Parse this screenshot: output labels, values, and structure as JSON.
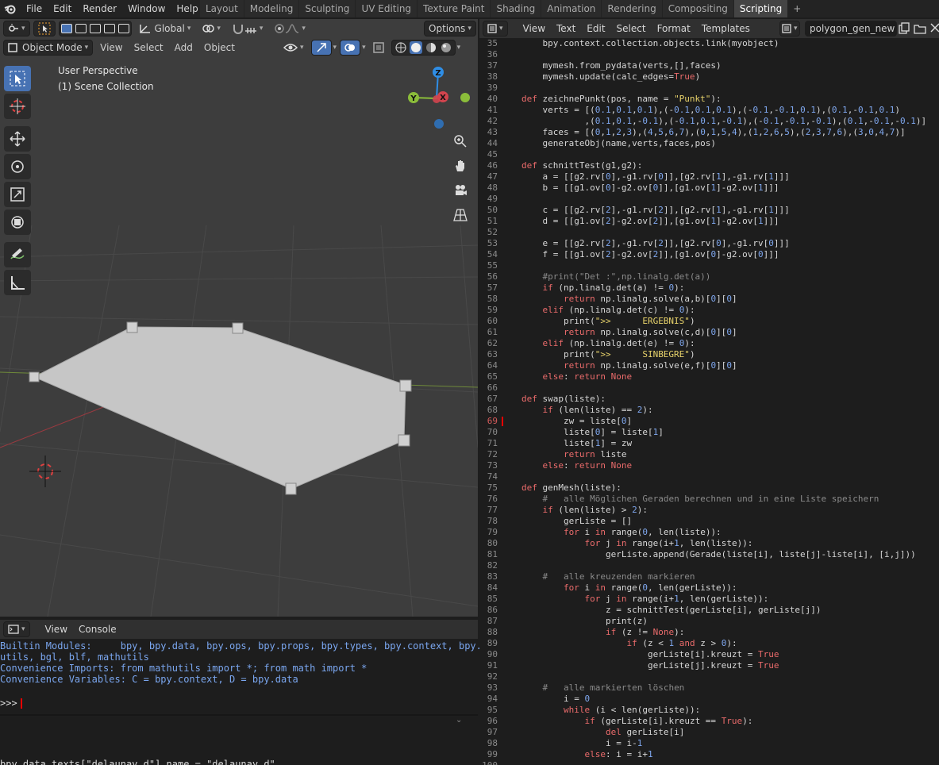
{
  "topbar": {
    "menus": [
      "File",
      "Edit",
      "Render",
      "Window",
      "Help"
    ],
    "workspaces": [
      "Layout",
      "Modeling",
      "Sculpting",
      "UV Editing",
      "Texture Paint",
      "Shading",
      "Animation",
      "Rendering",
      "Compositing",
      "Scripting"
    ],
    "active_workspace": "Scripting",
    "add_tab": "+"
  },
  "viewport": {
    "transform_orientation": "Global",
    "options_label": "Options",
    "mode": "Object Mode",
    "menus": [
      "View",
      "Select",
      "Add",
      "Object"
    ],
    "perspective": "User Perspective",
    "collection": "(1) Scene Collection",
    "gizmo_axes": {
      "z": "Z",
      "y": "Y",
      "x": "X"
    },
    "colors": {
      "background": "#3d3d3d",
      "mesh": "#c6c6c6",
      "x_axis": "#d1444e",
      "y_axis": "#8bbd3a",
      "z_axis": "#2f8ee6",
      "selection": "#4772b3"
    }
  },
  "console": {
    "menus": [
      "View",
      "Console"
    ],
    "lines": [
      "Builtin Modules:     bpy, bpy.data, bpy.ops, bpy.props, bpy.types, bpy.context, bpy.",
      "utils, bgl, blf, mathutils",
      "Convenience Imports: from mathutils import *; from math import *",
      "Convenience Variables: C = bpy.context, D = bpy.data"
    ],
    "prompt": ">>>"
  },
  "info": {
    "text": "bpy.data.texts[\"delaunay.d\"].name = \"delaunay.d\""
  },
  "editor": {
    "menus": [
      "View",
      "Text",
      "Edit",
      "Select",
      "Format",
      "Templates"
    ],
    "text_name": "polygon_gen_new",
    "current_line": 69,
    "lines": [
      {
        "n": "35",
        "t": "    bpy.context.collection.objects.link(myobject)"
      },
      {
        "n": "36",
        "t": ""
      },
      {
        "n": "37",
        "t": "    mymesh.from_pydata(verts,[],faces)"
      },
      {
        "n": "38",
        "t": "    mymesh.update(calc_edges=True)"
      },
      {
        "n": "39",
        "t": ""
      },
      {
        "n": "40",
        "t": "def zeichnePunkt(pos, name = \"Punkt\"):"
      },
      {
        "n": "41",
        "t": "    verts = [(0.1,0.1,0.1),(-0.1,0.1,0.1),(-0.1,-0.1,0.1),(0.1,-0.1,0.1)"
      },
      {
        "n": "42",
        "t": "            ,(0.1,0.1,-0.1),(-0.1,0.1,-0.1),(-0.1,-0.1,-0.1),(0.1,-0.1,-0.1)]"
      },
      {
        "n": "43",
        "t": "    faces = [(0,1,2,3),(4,5,6,7),(0,1,5,4),(1,2,6,5),(2,3,7,6),(3,0,4,7)]"
      },
      {
        "n": "44",
        "t": "    generateObj(name,verts,faces,pos)"
      },
      {
        "n": "45",
        "t": ""
      },
      {
        "n": "46",
        "t": "def schnittTest(g1,g2):"
      },
      {
        "n": "47",
        "t": "    a = [[g2.rv[0],-g1.rv[0]],[g2.rv[1],-g1.rv[1]]]"
      },
      {
        "n": "48",
        "t": "    b = [[g1.ov[0]-g2.ov[0]],[g1.ov[1]-g2.ov[1]]]"
      },
      {
        "n": "49",
        "t": ""
      },
      {
        "n": "50",
        "t": "    c = [[g2.rv[2],-g1.rv[2]],[g2.rv[1],-g1.rv[1]]]"
      },
      {
        "n": "51",
        "t": "    d = [[g1.ov[2]-g2.ov[2]],[g1.ov[1]-g2.ov[1]]]"
      },
      {
        "n": "52",
        "t": ""
      },
      {
        "n": "53",
        "t": "    e = [[g2.rv[2],-g1.rv[2]],[g2.rv[0],-g1.rv[0]]]"
      },
      {
        "n": "54",
        "t": "    f = [[g1.ov[2]-g2.ov[2]],[g1.ov[0]-g2.ov[0]]]"
      },
      {
        "n": "55",
        "t": ""
      },
      {
        "n": "56",
        "t": "    #print(\"Det :\",np.linalg.det(a))"
      },
      {
        "n": "57",
        "t": "    if (np.linalg.det(a) != 0):"
      },
      {
        "n": "58",
        "t": "        return np.linalg.solve(a,b)[0][0]"
      },
      {
        "n": "59",
        "t": "    elif (np.linalg.det(c) != 0):"
      },
      {
        "n": "60",
        "t": "        print(\">>      ERGEBNIS\")"
      },
      {
        "n": "61",
        "t": "        return np.linalg.solve(c,d)[0][0]"
      },
      {
        "n": "62",
        "t": "    elif (np.linalg.det(e) != 0):"
      },
      {
        "n": "63",
        "t": "        print(\">>      SINBEGRE\")"
      },
      {
        "n": "64",
        "t": "        return np.linalg.solve(e,f)[0][0]"
      },
      {
        "n": "65",
        "t": "    else: return None"
      },
      {
        "n": "66",
        "t": ""
      },
      {
        "n": "67",
        "t": "def swap(liste):"
      },
      {
        "n": "68",
        "t": "    if (len(liste) == 2):"
      },
      {
        "n": "69",
        "t": "        zw = liste[0]"
      },
      {
        "n": "70",
        "t": "        liste[0] = liste[1]"
      },
      {
        "n": "71",
        "t": "        liste[1] = zw"
      },
      {
        "n": "72",
        "t": "        return liste"
      },
      {
        "n": "73",
        "t": "    else: return None"
      },
      {
        "n": "74",
        "t": ""
      },
      {
        "n": "75",
        "t": "def genMesh(liste):"
      },
      {
        "n": "76",
        "t": "    #   alle Möglichen Geraden berechnen und in eine Liste speichern"
      },
      {
        "n": "77",
        "t": "    if (len(liste) > 2):"
      },
      {
        "n": "78",
        "t": "        gerListe = []"
      },
      {
        "n": "79",
        "t": "        for i in range(0, len(liste)):"
      },
      {
        "n": "80",
        "t": "            for j in range(i+1, len(liste)):"
      },
      {
        "n": "81",
        "t": "                gerListe.append(Gerade(liste[i], liste[j]-liste[i], [i,j]))"
      },
      {
        "n": "82",
        "t": ""
      },
      {
        "n": "83",
        "t": "    #   alle kreuzenden markieren"
      },
      {
        "n": "84",
        "t": "        for i in range(0, len(gerListe)):"
      },
      {
        "n": "85",
        "t": "            for j in range(i+1, len(gerListe)):"
      },
      {
        "n": "86",
        "t": "                z = schnittTest(gerListe[i], gerListe[j])"
      },
      {
        "n": "87",
        "t": "                print(z)"
      },
      {
        "n": "88",
        "t": "                if (z != None):"
      },
      {
        "n": "89",
        "t": "                    if (z < 1 and z > 0):"
      },
      {
        "n": "90",
        "t": "                        gerListe[i].kreuzt = True"
      },
      {
        "n": "91",
        "t": "                        gerListe[j].kreuzt = True"
      },
      {
        "n": "92",
        "t": ""
      },
      {
        "n": "93",
        "t": "    #   alle markierten löschen"
      },
      {
        "n": "94",
        "t": "        i = 0"
      },
      {
        "n": "95",
        "t": "        while (i < len(gerListe)):"
      },
      {
        "n": "96",
        "t": "            if (gerListe[i].kreuzt == True):"
      },
      {
        "n": "97",
        "t": "                del gerListe[i]"
      },
      {
        "n": "98",
        "t": "                i = i-1"
      },
      {
        "n": "99",
        "t": "            else: i = i+1"
      },
      {
        "n": "100",
        "t": ""
      }
    ]
  }
}
